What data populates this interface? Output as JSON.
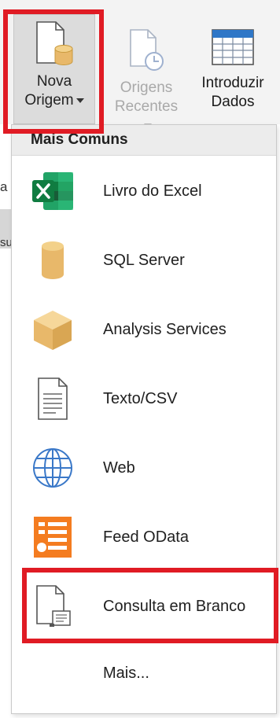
{
  "ribbon": {
    "new_source": {
      "line1": "Nova",
      "line2": "Origem"
    },
    "recent_sources": {
      "line1": "Origens",
      "line2": "Recentes"
    },
    "enter_data": {
      "line1": "Introduzir",
      "line2": "Dados"
    }
  },
  "background_edge": {
    "fragment_1": "a",
    "fragment_2": "su"
  },
  "menu": {
    "header": "Mais Comuns",
    "items": [
      {
        "label": "Livro do Excel",
        "icon": "excel-icon"
      },
      {
        "label": "SQL Server",
        "icon": "database-icon"
      },
      {
        "label": "Analysis Services",
        "icon": "cube-icon"
      },
      {
        "label": "Texto/CSV",
        "icon": "text-file-icon"
      },
      {
        "label": "Web",
        "icon": "globe-icon"
      },
      {
        "label": "Feed OData",
        "icon": "odata-icon"
      },
      {
        "label": "Consulta em Branco",
        "icon": "blank-query-icon"
      }
    ],
    "more": "Mais..."
  },
  "colors": {
    "highlight": "#e01b24",
    "excel_green": "#107c41",
    "db_gold": "#e8b86a",
    "odata_orange": "#f47c20",
    "globe_blue": "#3a78c8"
  }
}
